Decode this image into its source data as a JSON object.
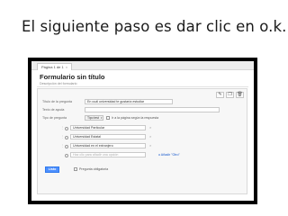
{
  "slide": {
    "title": "El siguiente paso es dar clic en o.k."
  },
  "tab": {
    "label": "Página 1 de 1",
    "close": "×"
  },
  "form": {
    "title": "Formulario sin título",
    "description": "Descripción del formulario"
  },
  "toolbar": {
    "edit": "✎",
    "copy": "❐",
    "delete": "🗑"
  },
  "question": {
    "title_label": "Título de la pregunta",
    "title_value": "En cuál universidad te gustaría estudiar",
    "help_label": "Texto de ayuda",
    "help_value": "",
    "type_label": "Tipo de pregunta",
    "type_value": "Tipo test",
    "type_arrow": "▾",
    "go_to_page_label": "Ir a la página según la respuesta"
  },
  "options": [
    {
      "value": "Universidad Particular",
      "remove": "×"
    },
    {
      "value": "Universidad Estatal",
      "remove": "×"
    },
    {
      "value": "Universidad en el extranjero",
      "remove": "×"
    }
  ],
  "new_option": {
    "placeholder": "Haz clic para añadir una opción",
    "add_other": "o Añadir \"Otro\""
  },
  "footer": {
    "done_label": "Listo",
    "required_label": "Pregunta obligatoria"
  }
}
